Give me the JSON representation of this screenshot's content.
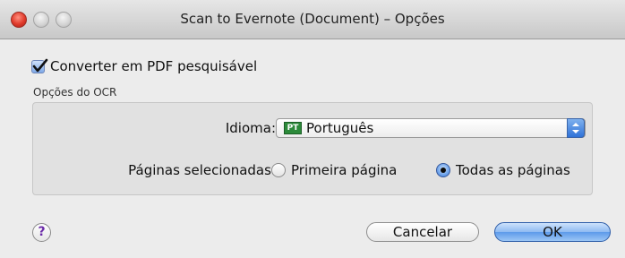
{
  "window": {
    "title": "Scan to Evernote (Document) – Opções"
  },
  "options": {
    "convert_pdf_label": "Converter em PDF pesquisável",
    "convert_pdf_checked": true
  },
  "ocr": {
    "group_label": "Opções do OCR",
    "language_label": "Idioma:",
    "language_flag": "PT",
    "language_value": "Português",
    "pages_label": "Páginas selecionadas:",
    "pages_options": [
      {
        "label": "Primeira página",
        "selected": false
      },
      {
        "label": "Todas as páginas",
        "selected": true
      }
    ]
  },
  "buttons": {
    "help_label": "?",
    "cancel_label": "Cancelar",
    "ok_label": "OK"
  },
  "icons": {
    "close": "close-traffic-light",
    "minimize": "minimize-traffic-light",
    "zoom": "zoom-traffic-light",
    "language_flag": "pt-flag-icon",
    "stepper": "select-stepper-icon",
    "help": "help-icon"
  },
  "colors": {
    "accent": "#5d9aea",
    "close_red": "#e0392a",
    "flag_green": "#2c8a3a"
  }
}
